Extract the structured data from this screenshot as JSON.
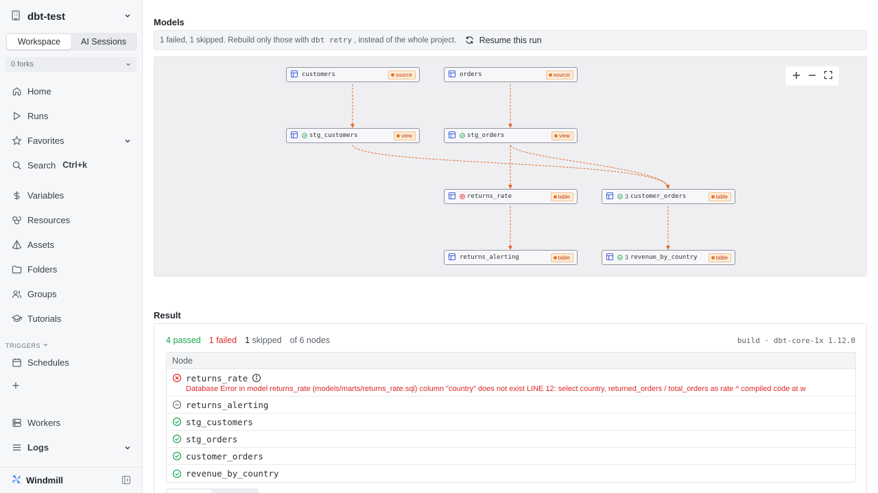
{
  "workspace": {
    "name": "dbt-test"
  },
  "tabs": {
    "workspace": "Workspace",
    "ai_sessions": "AI Sessions"
  },
  "forks": {
    "label": "0 forks"
  },
  "nav": {
    "home": "Home",
    "runs": "Runs",
    "favorites": "Favorites",
    "search": "Search",
    "search_shortcut": "Ctrl+k",
    "variables": "Variables",
    "resources": "Resources",
    "assets": "Assets",
    "folders": "Folders",
    "groups": "Groups",
    "tutorials": "Tutorials",
    "triggers": "TRIGGERS",
    "schedules": "Schedules",
    "workers": "Workers",
    "logs": "Logs"
  },
  "brand": {
    "name": "Windmill"
  },
  "models": {
    "title": "Models",
    "retry_prefix": "1 failed, 1 skipped. Rebuild only those with",
    "retry_code": "dbt retry",
    "retry_suffix": ", instead of the whole project.",
    "resume_label": "Resume this run"
  },
  "dag_nodes": [
    {
      "name": "customers",
      "badge": "source",
      "status": "",
      "count": ""
    },
    {
      "name": "orders",
      "badge": "source",
      "status": "",
      "count": ""
    },
    {
      "name": "stg_customers",
      "badge": "view",
      "status": "passed",
      "count": ""
    },
    {
      "name": "stg_orders",
      "badge": "view",
      "status": "passed",
      "count": ""
    },
    {
      "name": "returns_rate",
      "badge": "table",
      "status": "failed",
      "count": ""
    },
    {
      "name": "customer_orders",
      "badge": "table",
      "status": "passed",
      "count": "3"
    },
    {
      "name": "returns_alerting",
      "badge": "table",
      "status": "",
      "count": ""
    },
    {
      "name": "revenue_by_country",
      "badge": "table",
      "status": "passed",
      "count": "3"
    }
  ],
  "result": {
    "title": "Result",
    "passed_count": "4",
    "passed_label": "passed",
    "failed_count": "1",
    "failed_label": "failed",
    "skipped_count": "1",
    "skipped_label": "skipped",
    "total_label": "of 6 nodes",
    "build_info": "build · dbt-core-1x 1.12.0",
    "column_header": "Node",
    "rows": [
      {
        "name": "returns_rate",
        "status": "failed",
        "error": "Database Error in model returns_rate (models/marts/returns_rate.sql) column \"country\" does not exist LINE 12: select country, returned_orders / total_orders as rate ^ compiled code at w"
      },
      {
        "name": "returns_alerting",
        "status": "skipped"
      },
      {
        "name": "stg_customers",
        "status": "passed"
      },
      {
        "name": "stg_orders",
        "status": "passed"
      },
      {
        "name": "customer_orders",
        "status": "passed"
      },
      {
        "name": "revenue_by_country",
        "status": "passed"
      }
    ]
  },
  "colors": {
    "passed": "#16a34a",
    "failed": "#dc2626",
    "edge": "#e06a2a",
    "badge_bg": "#fdecd8"
  }
}
